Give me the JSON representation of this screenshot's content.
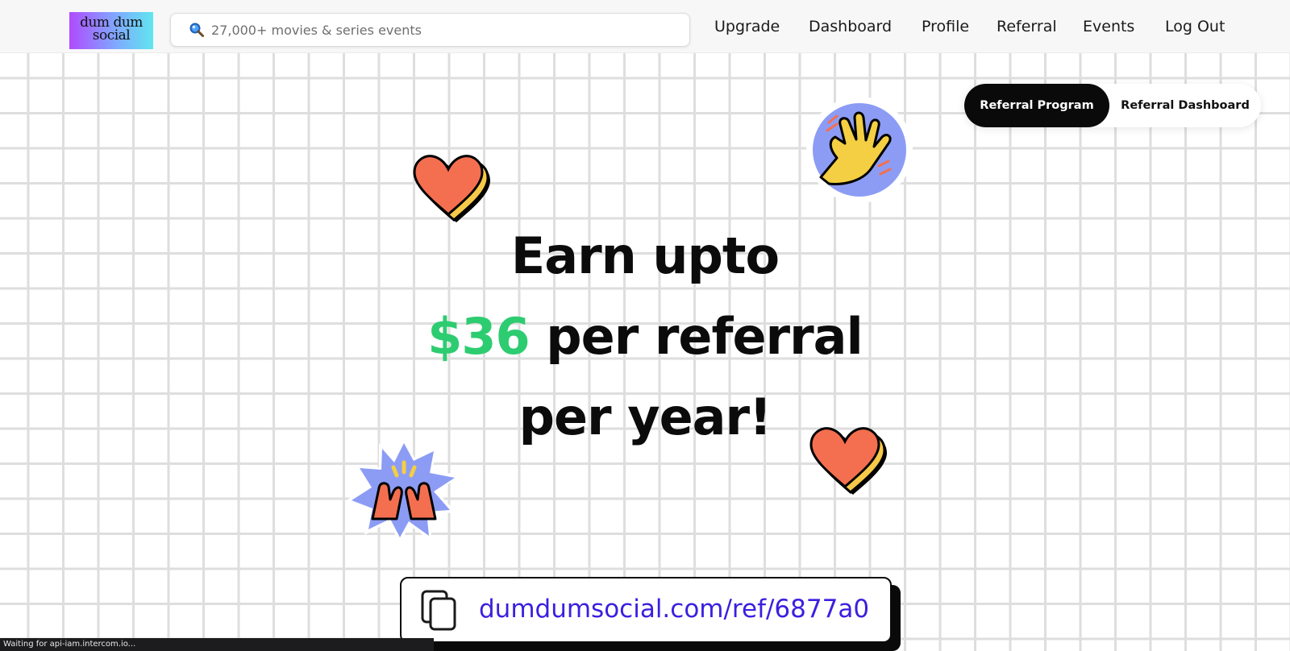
{
  "brand": {
    "logo_line1": "dum dum",
    "logo_line2": "social"
  },
  "search": {
    "placeholder": "27,000+ movies & series events",
    "icon": "search-icon"
  },
  "nav": {
    "items": [
      {
        "label": "Upgrade"
      },
      {
        "label": "Dashboard"
      },
      {
        "label": "Profile"
      },
      {
        "label": "Referral"
      },
      {
        "label": "Events"
      },
      {
        "label": "Log Out"
      }
    ]
  },
  "tabs": {
    "active_label": "Referral Program",
    "inactive_label": "Referral Dashboard"
  },
  "hero": {
    "line1": "Earn upto",
    "amount": "$36",
    "line2_rest": " per referral",
    "line3": "per year!"
  },
  "referral_link": {
    "url": "dumdumsocial.com/ref/6877a0",
    "icon": "copy-icon"
  },
  "status": {
    "text": "Waiting for api-iam.intercom.io..."
  },
  "colors": {
    "accent_green": "#2ecc71",
    "link_blue": "#3a1fe0",
    "heart": "#f46f4f",
    "heart_shadow": "#f7c948",
    "sticker_blue": "#8c9cf5",
    "hand_yellow": "#f4cf43"
  },
  "stickers": [
    "heart-sticker",
    "waving-hand-sticker",
    "clapping-hands-sticker",
    "heart-sticker"
  ]
}
